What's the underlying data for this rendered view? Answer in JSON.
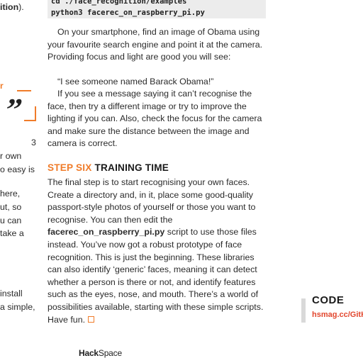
{
  "left_column": {
    "line1_bold": "ition",
    "line1_rest": ").",
    "orange_fragment": "r",
    "quote_glyph": "”",
    "lines": [
      "3",
      "r own",
      "o easy is",
      "here,",
      "ut, so",
      "u can",
      "take a",
      "install",
      "a simple,"
    ]
  },
  "code_block": {
    "line1": "cd ./face_recognition/examples",
    "line2": "python3 facerec_on_raspberry_pi.py"
  },
  "article": {
    "para1": "On your smartphone, find an image of Obama using your favourite search engine and point it at the camera. Providing focus and light are good you will see:",
    "para2": "“I see someone named Barack Obama!”",
    "para3": "If you see a message saying it can’t recognise the face, then try a different image or try to improve the lighting if you can. Also, check the focus for the camera and make sure the distance between the image and camera is correct.",
    "heading_accent": "STEP SIX",
    "heading_rest": "TRAINING TIME",
    "para4_a": "The final step is to start recognising your own faces. Create a directory and, in it, place some good-quality passport-style photos of yourself or those you want to recognise. You can then edit the",
    "para4_bold": "facerec_on_raspberry_pi.py",
    "para4_b": "script to use those files instead. You’ve now got a robust prototype of face recognition. This is just the beginning. These libraries can also identify ‘generic’ faces, meaning it can detect whether a person is there or not, and identify features such as the eyes, nose, and mouth. There’s a world of possibilities available, starting with these simple scripts. Have fun."
  },
  "sidebar_code": {
    "title": "CODE",
    "link": "hsmag.cc/GitHu"
  },
  "footer": {
    "brand_bold": "Hack",
    "brand_rest": "Space"
  },
  "colors": {
    "accent_orange": "#f07c2a",
    "link_red": "#e2462d"
  }
}
